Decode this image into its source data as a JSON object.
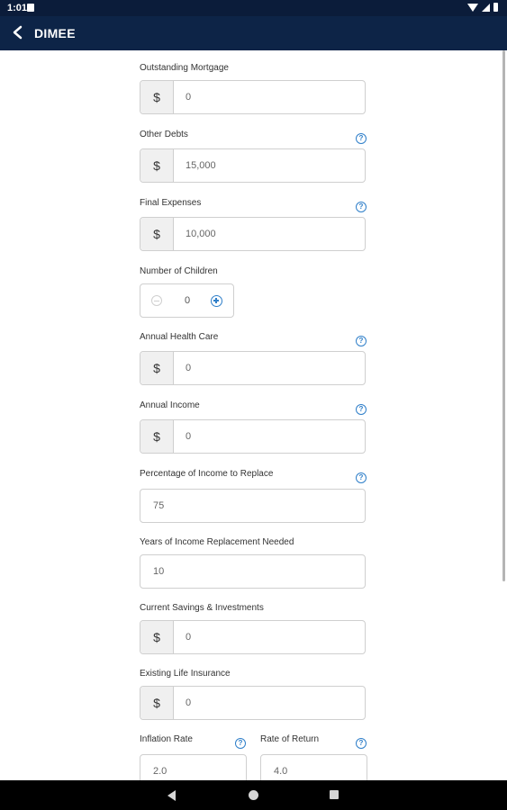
{
  "status": {
    "time": "1:01"
  },
  "appbar": {
    "title": "DIMEE"
  },
  "fields": {
    "mortgage": {
      "label": "Outstanding Mortgage",
      "prefix": "$",
      "value": "0"
    },
    "other_debts": {
      "label": "Other Debts",
      "prefix": "$",
      "value": "15,000"
    },
    "final_expenses": {
      "label": "Final Expenses",
      "prefix": "$",
      "value": "10,000"
    },
    "children": {
      "label": "Number of Children",
      "value": "0"
    },
    "health_care": {
      "label": "Annual Health Care",
      "prefix": "$",
      "value": "0"
    },
    "income": {
      "label": "Annual Income",
      "prefix": "$",
      "value": "0"
    },
    "pct_replace": {
      "label": "Percentage of Income to Replace",
      "value": "75"
    },
    "years_replace": {
      "label": "Years of Income Replacement Needed",
      "value": "10"
    },
    "savings": {
      "label": "Current Savings & Investments",
      "prefix": "$",
      "value": "0"
    },
    "life_insurance": {
      "label": "Existing Life Insurance",
      "prefix": "$",
      "value": "0"
    },
    "inflation": {
      "label": "Inflation Rate",
      "value": "2.0"
    },
    "return": {
      "label": "Rate of Return",
      "value": "4.0"
    }
  },
  "icons": {
    "help": "?"
  }
}
